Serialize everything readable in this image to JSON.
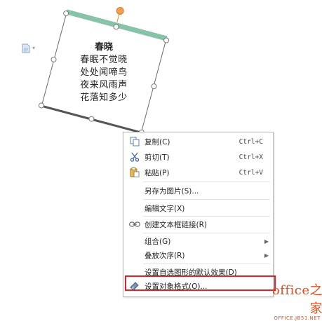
{
  "poem": {
    "title": "春晓",
    "lines": [
      "春眠不觉晓",
      "处处闻啼鸟",
      "夜来风雨声",
      "花落知多少"
    ]
  },
  "context_menu": {
    "copy": {
      "label": "复制(C)",
      "shortcut": "Ctrl+C",
      "icon": "copy-icon"
    },
    "cut": {
      "label": "剪切(T)",
      "shortcut": "Ctrl+X",
      "icon": "scissors-icon"
    },
    "paste": {
      "label": "粘贴(P)",
      "shortcut": "Ctrl+V",
      "icon": "clipboard-icon"
    },
    "save_as_image": {
      "label": "另存为图片(S)..."
    },
    "edit_text": {
      "label": "编辑文字(X)"
    },
    "create_link": {
      "label": "创建文本框链接(R)",
      "icon": "link-icon"
    },
    "group": {
      "label": "组合(G)"
    },
    "order": {
      "label": "叠放次序(R)"
    },
    "set_default": {
      "label": "设置自选图形的默认效果(D)"
    },
    "format_object": {
      "label": "设置对象格式(O)...",
      "icon": "format-brush-icon"
    }
  },
  "watermark": {
    "main": "office之家",
    "url": "OFFICE.JB51.NET"
  },
  "colors": {
    "highlight": "#d9232a",
    "shape_band": "#86c3a8",
    "watermark": "#e84c1c"
  }
}
